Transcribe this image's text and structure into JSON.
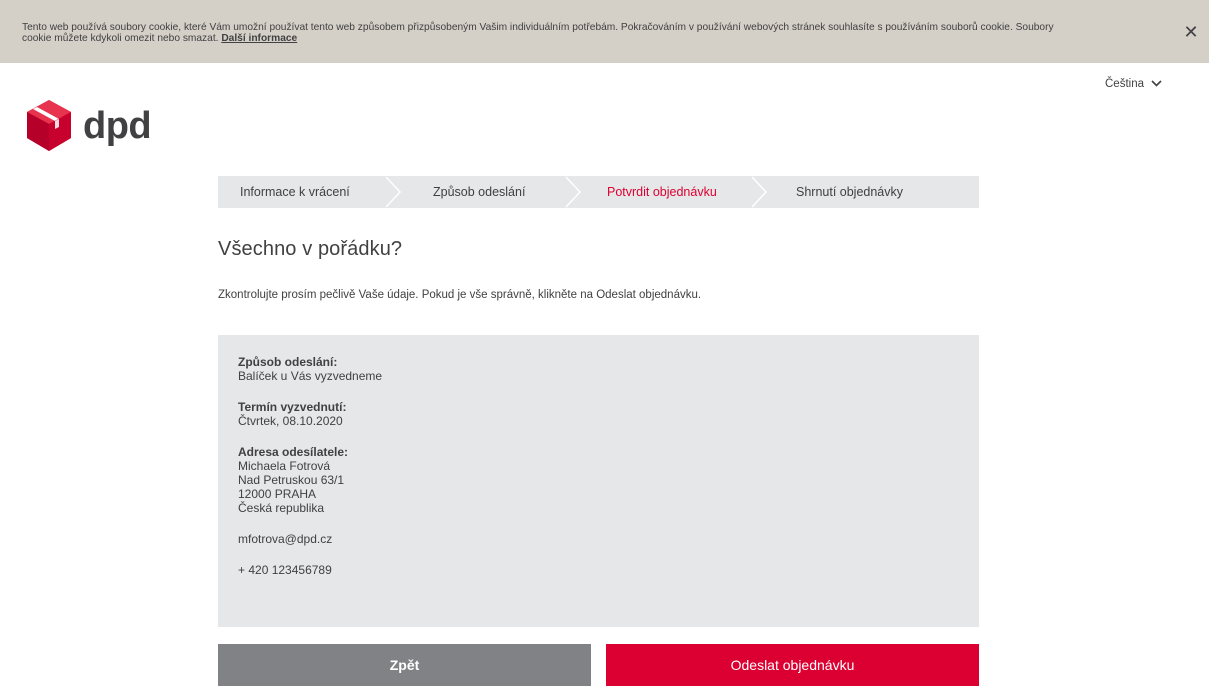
{
  "cookie": {
    "text": "Tento web používá soubory cookie, které Vám umožní používat tento web způsobem přizpůsobeným Vašim individuálním potřebám. Pokračováním v používání webových stránek souhlasíte s používáním souborů cookie. Soubory cookie můžete kdykoli omezit nebo smazat. ",
    "link": "Další informace",
    "close": "✕"
  },
  "language": {
    "label": "Čeština",
    "icon": "chevron-down-icon"
  },
  "logo": {
    "text": "dpd",
    "icon": "dpd-cube-logo",
    "color": "#dc0032"
  },
  "steps": [
    {
      "label": "Informace k vrácení",
      "active": false
    },
    {
      "label": "Způsob odeslání",
      "active": false
    },
    {
      "label": "Potvrdit objednávku",
      "active": true
    },
    {
      "label": "Shrnutí objednávky",
      "active": false
    }
  ],
  "heading": "Všechno v pořádku?",
  "intro": "Zkontrolujte prosím pečlivě Vaše údaje. Pokud je vše správně, klikněte na Odeslat objednávku.",
  "summary": {
    "shipping_label": "Způsob odeslání:",
    "shipping_value": "Balíček u Vás vyzvedneme",
    "pickup_label": "Termín vyzvednutí:",
    "pickup_value": "Čtvrtek, 08.10.2020",
    "sender_label": "Adresa odesílatele:",
    "sender_lines": [
      "Michaela Fotrová",
      "Nad Petruskou 63/1",
      "12000 PRAHA",
      "Česká republika"
    ],
    "email": "mfotrova@dpd.cz",
    "phone": "+ 420 123456789"
  },
  "buttons": {
    "back": "Zpět",
    "send": "Odeslat objednávku"
  },
  "colors": {
    "accent": "#dc0032",
    "panel": "#e6e7e8",
    "button_gray": "#808285",
    "cookie_bg": "#d4d0c8"
  }
}
